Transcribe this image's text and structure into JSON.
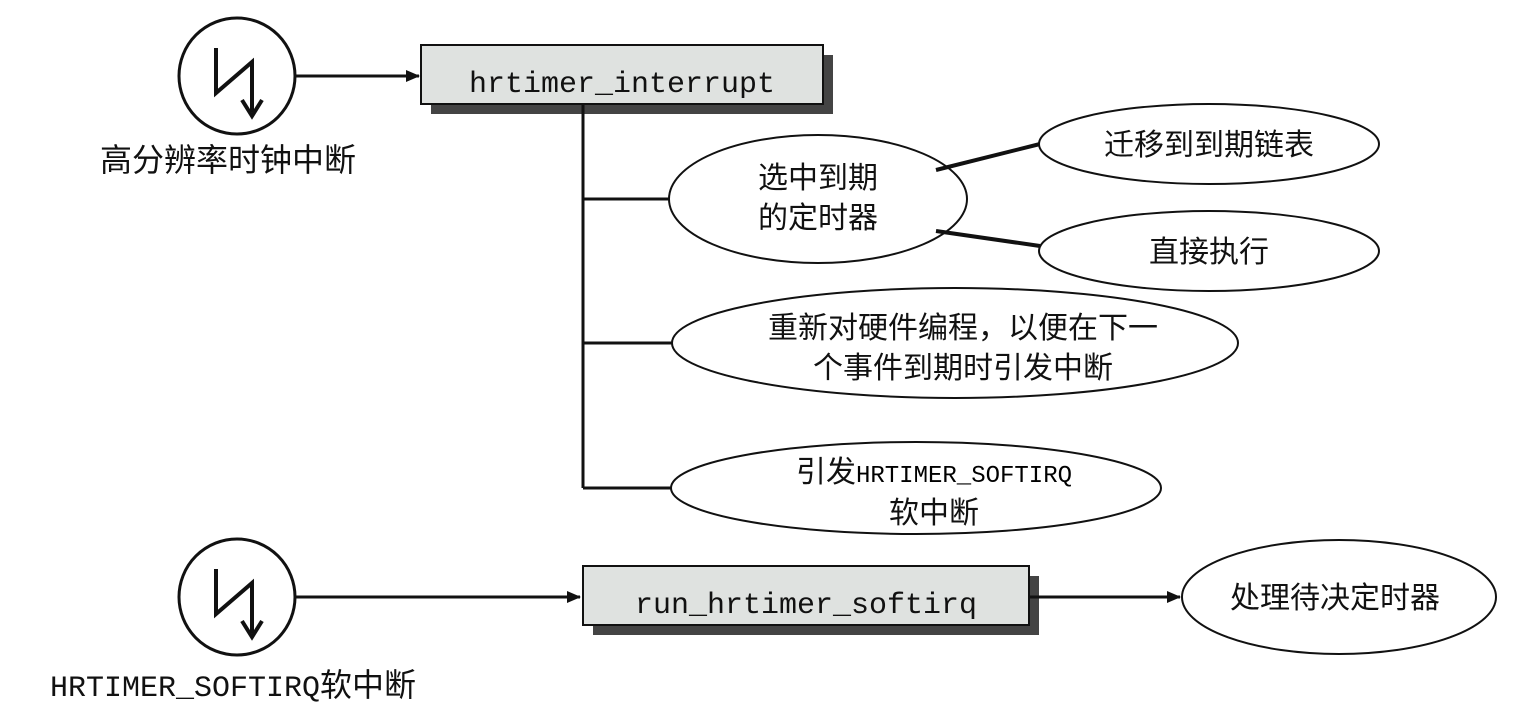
{
  "interrupt_top": {
    "caption": "高分辨率时钟中断",
    "icon": "lightning-interrupt-icon"
  },
  "hrtimer_interrupt_box": {
    "label": "hrtimer_interrupt"
  },
  "steps": {
    "select_expired": {
      "line1": "选中到期",
      "line2": "的定时器"
    },
    "migrate": {
      "label": "迁移到到期链表"
    },
    "execute": {
      "label": "直接执行"
    },
    "reprogram": {
      "line1": "重新对硬件编程，以便在下一",
      "line2": "个事件到期时引发中断"
    },
    "raise_softirq": {
      "line1_prefix": "引发",
      "line1_code": "HRTIMER_SOFTIRQ",
      "line2": "软中断"
    }
  },
  "interrupt_bottom": {
    "caption_code": "HRTIMER_SOFTIRQ",
    "caption_suffix": "软中断",
    "icon": "lightning-interrupt-icon"
  },
  "run_hrtimer_softirq_box": {
    "label": "run_hrtimer_softirq"
  },
  "pending": {
    "label": "处理待决定时器"
  },
  "colors": {
    "box_fill": "#dfe2e0",
    "shadow": "#444444",
    "stroke": "#111111"
  }
}
